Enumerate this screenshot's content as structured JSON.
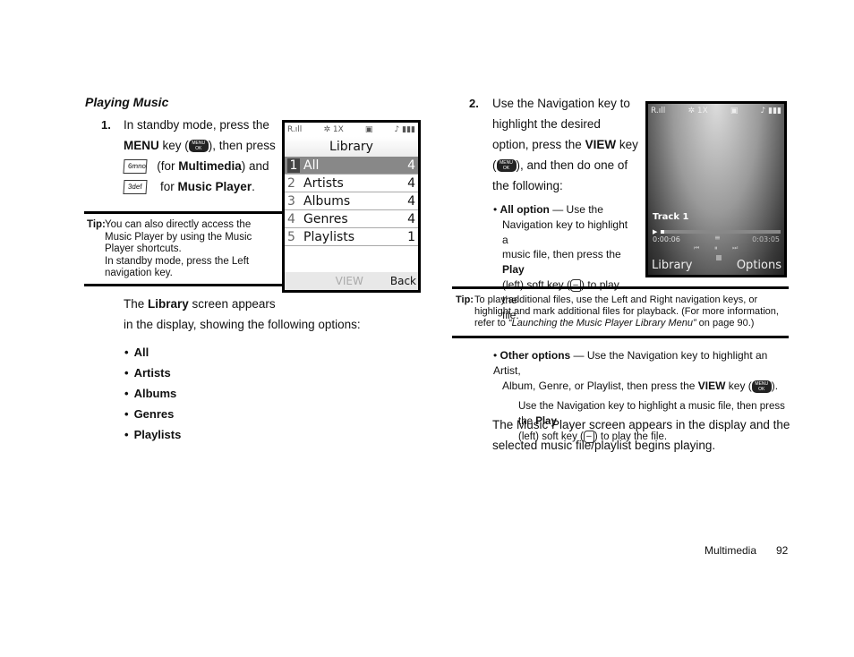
{
  "section_title": "Playing Music",
  "step1": {
    "number": "1.",
    "line1": "In standby mode, press the",
    "menu_label": "MENU",
    "key_open": " key (",
    "key_close": "), then press",
    "menu_key_icon_text": "MENU OK",
    "key6_text": "6mno",
    "for_multimedia_pre": "(for ",
    "multimedia_label": "Multimedia",
    "for_multimedia_post": ") and",
    "key3_text": "3def",
    "for_music_pre": "for ",
    "music_player_label": "Music Player",
    "period": "."
  },
  "tip1": {
    "label": "Tip:",
    "lines": [
      "You can also directly access the",
      "Music Player by using the Music",
      "Player shortcuts.",
      "In standby mode, press the Left",
      "navigation key."
    ]
  },
  "library_screen": {
    "status_left": "R.ıll",
    "status_mid": "✲ 1X",
    "status_sd": "▣",
    "status_right": "♪ ▮▮▮",
    "title": "Library",
    "items": [
      {
        "num": "1",
        "label": "All",
        "count": "4",
        "selected": true
      },
      {
        "num": "2",
        "label": "Artists",
        "count": "4"
      },
      {
        "num": "3",
        "label": "Albums",
        "count": "4"
      },
      {
        "num": "4",
        "label": "Genres",
        "count": "4"
      },
      {
        "num": "5",
        "label": "Playlists",
        "count": "1"
      }
    ],
    "soft_center": "VIEW",
    "soft_right": "Back"
  },
  "library_caption": {
    "pre": "The ",
    "bold": "Library",
    "post": " screen appears",
    "line2": "in the display, showing the following options:"
  },
  "options_list": [
    "All",
    "Artists",
    "Albums",
    "Genres",
    "Playlists"
  ],
  "step2": {
    "number": "2.",
    "lines": [
      "Use the Navigation key to",
      "highlight the desired"
    ],
    "line3_pre": "option, press the ",
    "view_label": "VIEW",
    "line3_post": " key",
    "line4_open": "(",
    "line4_post": "), and then do one of",
    "line5": "the following:"
  },
  "all_option": {
    "label": "All option",
    "line1": " — Use the",
    "line2": "Navigation key to highlight a",
    "line3_pre": "music file, then press the ",
    "play_label": "Play",
    "line4_pre": "(left) soft key (",
    "line4_post": ") to play the",
    "line5": "file."
  },
  "player_screen": {
    "status_left": "R.ıll",
    "status_mid": "✲ 1X",
    "status_sd": "▣",
    "status_right": "♪ ▮▮▮",
    "track": "Track 1",
    "elapsed": "0:00:06",
    "total": "0:03:05",
    "progress_fraction": 0.03,
    "soft_left": "Library",
    "soft_right": "Options"
  },
  "tip2": {
    "label": "Tip:",
    "line1": "To play additional files, use the Left and Right navigation keys, or",
    "line2": "highlight and mark additional files for playback. (For more information,",
    "line3_pre": "refer to ",
    "line3_link": "“Launching the Music Player Library Menu”",
    "line3_post": "  on page 90.)"
  },
  "other_options": {
    "label": "Other options",
    "line1": " — Use the Navigation key to highlight an Artist,",
    "line2_pre": "Album, Genre, or Playlist, then press the ",
    "view_label": "VIEW",
    "line2_mid": " key (",
    "line2_post": ").",
    "sub_line1_pre": "Use the Navigation key to highlight a music file, then press the ",
    "play_label": "Play",
    "sub_line2_pre": "(left) soft key (",
    "sub_line2_post": ") to play the file."
  },
  "closing": {
    "line1": "The Music Player screen appears in the display and the",
    "line2": "selected music file/playlist begins playing."
  },
  "footer": {
    "section": "Multimedia",
    "page": "92"
  }
}
